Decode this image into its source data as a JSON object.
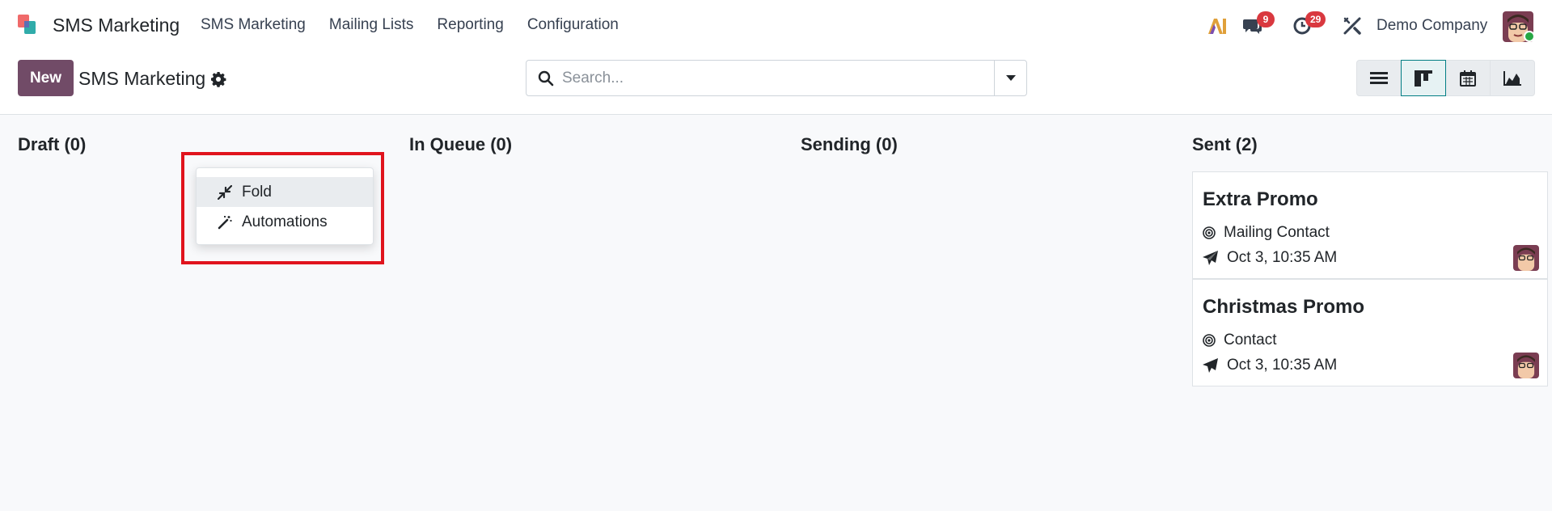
{
  "navbar": {
    "app_name": "SMS Marketing",
    "menu": [
      "SMS Marketing",
      "Mailing Lists",
      "Reporting",
      "Configuration"
    ],
    "messages_badge": "9",
    "activities_badge": "29",
    "company": "Demo Company"
  },
  "control": {
    "new_label": "New",
    "title": "SMS Marketing",
    "search_placeholder": "Search..."
  },
  "kanban": {
    "columns": [
      {
        "title": "Draft (0)"
      },
      {
        "title": "In Queue (0)"
      },
      {
        "title": "Sending (0)"
      },
      {
        "title": "Sent (2)"
      }
    ],
    "cards": [
      {
        "title": "Extra Promo",
        "target": "Mailing Contact",
        "sent": "Oct 3, 10:35 AM"
      },
      {
        "title": "Christmas Promo",
        "target": "Contact",
        "sent": "Oct 3, 10:35 AM"
      }
    ]
  },
  "dropdown": {
    "items": [
      "Fold",
      "Automations"
    ]
  },
  "colors": {
    "brand": "#714b67",
    "accent": "#017e84",
    "badge": "#d9383f",
    "highlight_box": "#e0141d"
  }
}
